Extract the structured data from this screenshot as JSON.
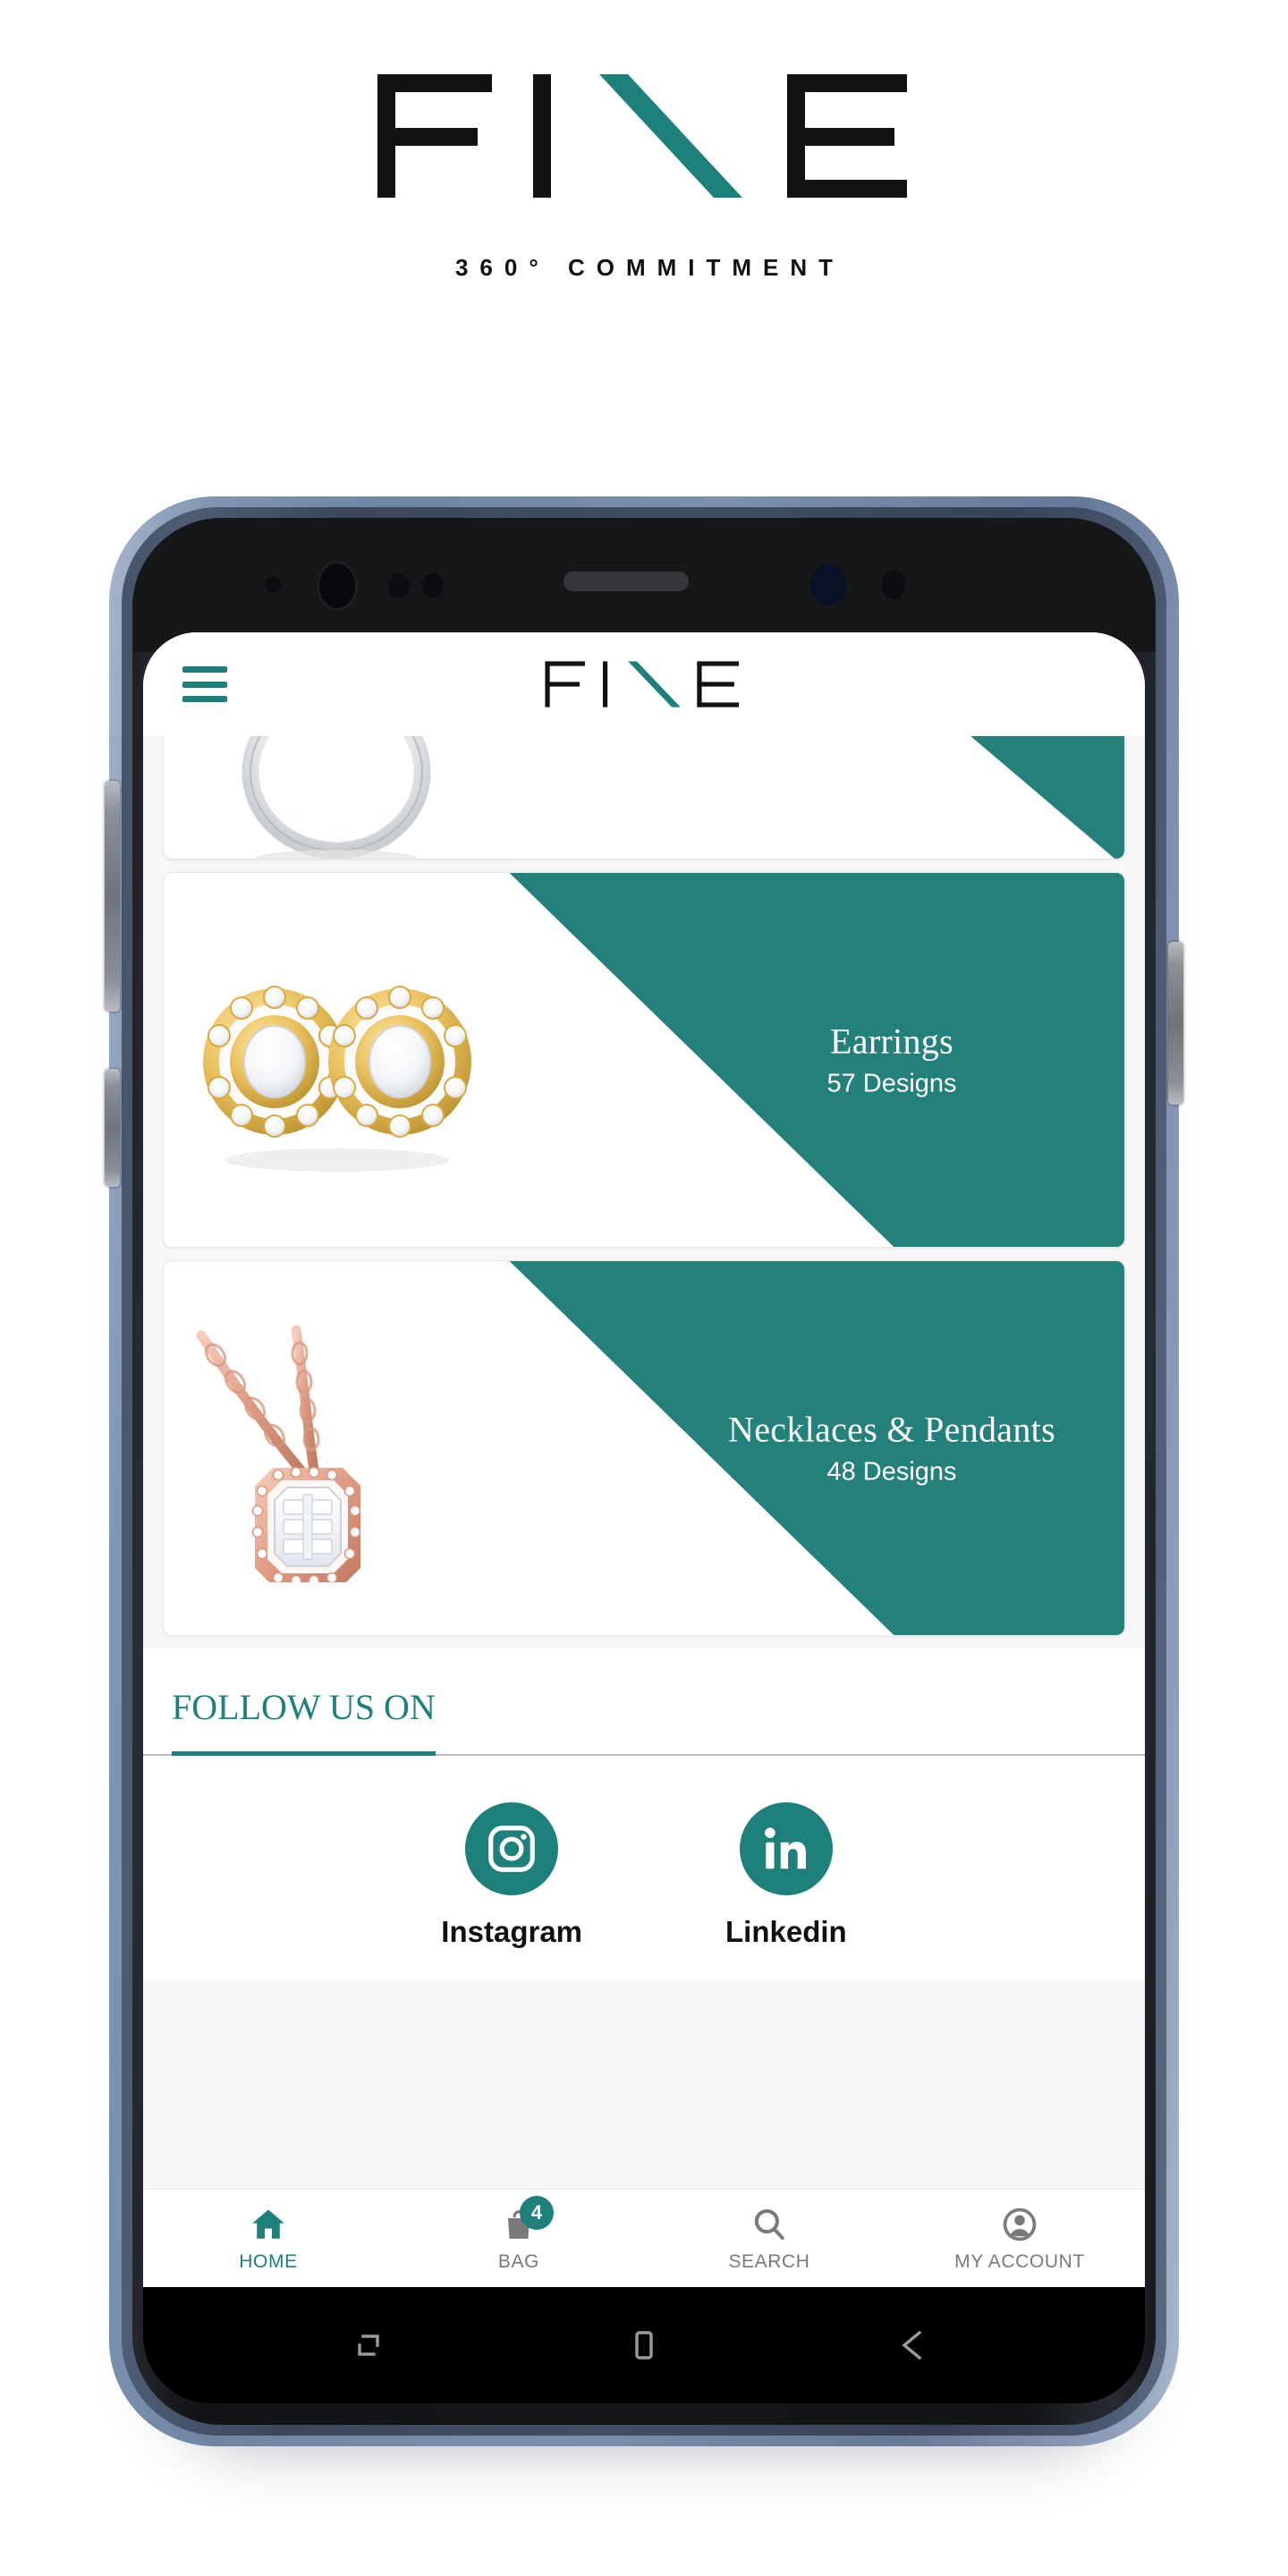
{
  "brand": {
    "logo_text": "FINE",
    "tagline": "360° COMMITMENT",
    "accent_color": "#1e807b",
    "dark_color": "#111111"
  },
  "app": {
    "header": {
      "menu_icon": "hamburger-menu-icon",
      "logo_text": "FINE"
    },
    "categories": [
      {
        "id": "rings",
        "title": "",
        "count": "",
        "image": "diamond-ring-photo",
        "partial": true
      },
      {
        "id": "earrings",
        "title": "Earrings",
        "count": "57 Designs",
        "image": "diamond-halo-stud-earrings-photo",
        "partial": false
      },
      {
        "id": "necklaces-pendants",
        "title": "Necklaces & Pendants",
        "count": "48 Designs",
        "image": "rose-gold-emerald-cut-pendant-photo",
        "partial": false
      }
    ],
    "follow": {
      "heading": "FOLLOW US ON",
      "socials": [
        {
          "id": "instagram",
          "label": "Instagram",
          "icon": "instagram-icon"
        },
        {
          "id": "linkedin",
          "label": "Linkedin",
          "icon": "linkedin-icon"
        }
      ]
    },
    "tabbar": [
      {
        "id": "home",
        "label": "HOME",
        "icon": "home-icon",
        "active": true,
        "badge": ""
      },
      {
        "id": "bag",
        "label": "BAG",
        "icon": "bag-icon",
        "active": false,
        "badge": "4"
      },
      {
        "id": "search",
        "label": "SEARCH",
        "icon": "search-icon",
        "active": false,
        "badge": ""
      },
      {
        "id": "my-account",
        "label": "MY ACCOUNT",
        "icon": "person-icon",
        "active": false,
        "badge": ""
      }
    ]
  },
  "device": {
    "os_nav": [
      {
        "id": "recents",
        "icon": "recents-icon"
      },
      {
        "id": "home",
        "icon": "home-square-icon"
      },
      {
        "id": "back",
        "icon": "back-arrow-icon"
      }
    ],
    "sensors": [
      "proximity-sensor",
      "front-camera",
      "light-sensor",
      "secondary-sensor",
      "earpiece-speaker",
      "iris-scanner",
      "ir-emitter"
    ],
    "buttons": [
      "volume-rocker",
      "bixby-button",
      "power-button"
    ]
  }
}
